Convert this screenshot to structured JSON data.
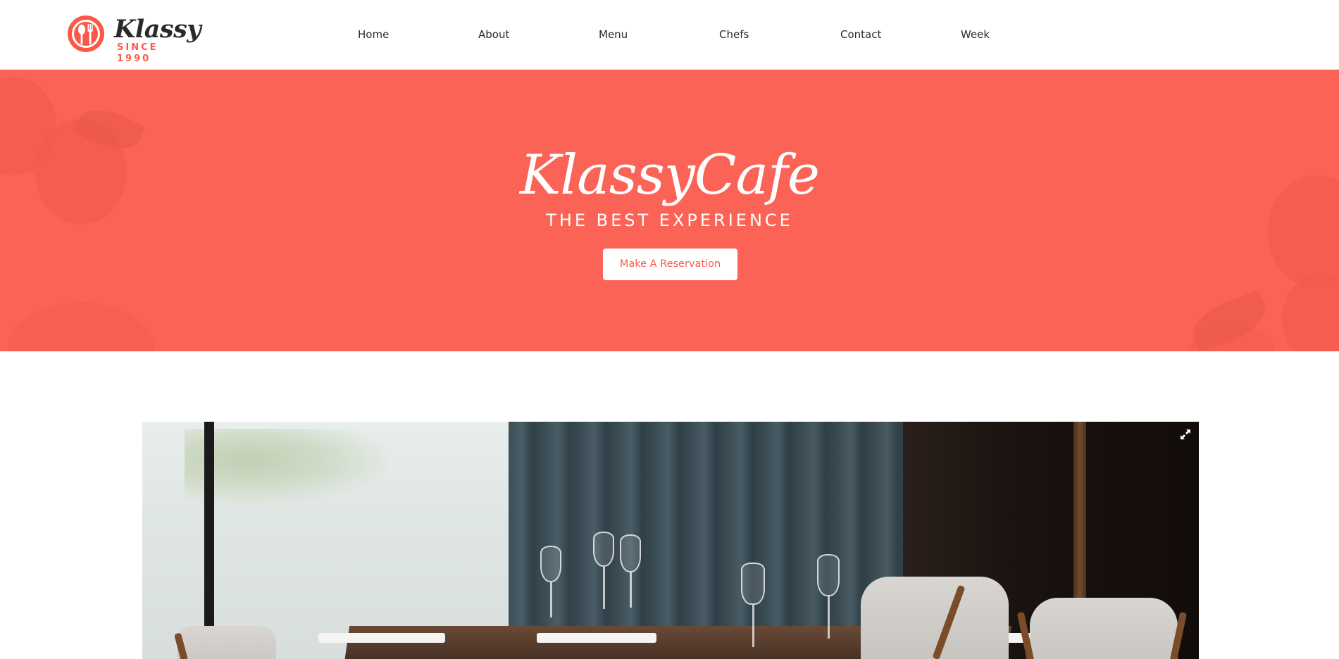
{
  "header": {
    "logo": {
      "word": "Klassy",
      "since": "SINCE 1990"
    },
    "nav": [
      "Home",
      "About",
      "Menu",
      "Chefs",
      "Contact",
      "Week"
    ]
  },
  "hero": {
    "title": "KlassyCafe",
    "subtitle": "THE BEST EXPERIENCE",
    "button_label": "Make A Reservation"
  },
  "photo": {
    "expand_icon": "expand-icon"
  },
  "colors": {
    "accent": "#fb5849",
    "hero_bg": "#fb6356",
    "text_dark": "#2a2a2a"
  }
}
